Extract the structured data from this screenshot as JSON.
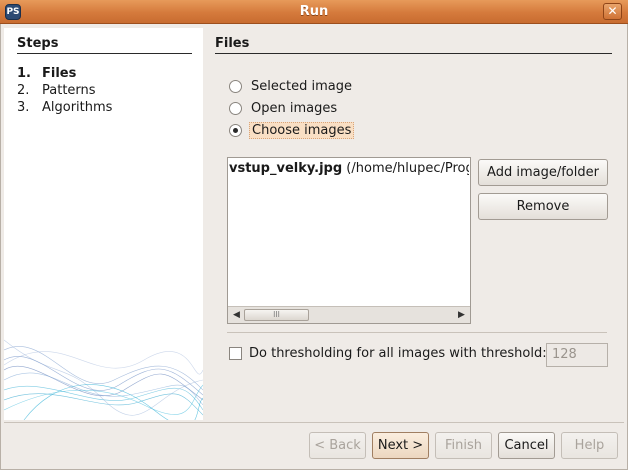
{
  "window": {
    "title": "Run",
    "app_icon_text": "PS",
    "close_glyph": "✕"
  },
  "steps": {
    "heading": "Steps",
    "items": [
      {
        "number": "1.",
        "label": "Files",
        "current": true
      },
      {
        "number": "2.",
        "label": "Patterns",
        "current": false
      },
      {
        "number": "3.",
        "label": "Algorithms",
        "current": false
      }
    ]
  },
  "files": {
    "heading": "Files",
    "options": [
      {
        "label": "Selected image",
        "checked": false
      },
      {
        "label": "Open images",
        "checked": false
      },
      {
        "label": "Choose images",
        "checked": true
      }
    ],
    "list": [
      {
        "name": "vstup_velky.jpg",
        "path": " (/home/hlupec/Prog"
      }
    ],
    "add_button": "Add image/folder",
    "remove_button": "Remove",
    "scroll_thumb_glyph": "lll",
    "threshold": {
      "label": "Do thresholding for all images with threshold:",
      "checked": false,
      "value": "128"
    }
  },
  "footer": {
    "back": "< Back",
    "next": "Next >",
    "finish": "Finish",
    "cancel": "Cancel",
    "help": "Help"
  },
  "colors": {
    "titlebar": "#d57a3c",
    "window_bg": "#efebe7",
    "focus_highlight": "#f9dfc4"
  }
}
